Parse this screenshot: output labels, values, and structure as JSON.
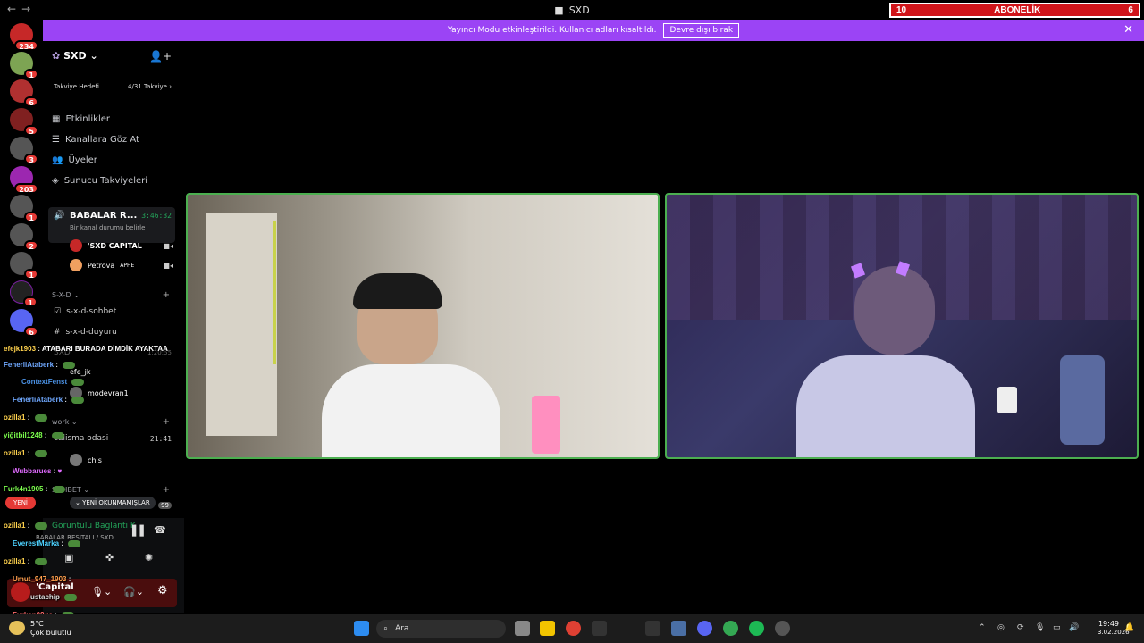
{
  "titlebar": {
    "title": "SXD",
    "nav_back": "←",
    "nav_fwd": "→"
  },
  "subscriber": {
    "left": "10",
    "label": "ABONELİK",
    "right": "6"
  },
  "banner": {
    "text": "Yayıncı Modu etkinleştirildi. Kullanıcı adları kısaltıldı.",
    "button": "Devre dışı bırak"
  },
  "guild_badges": [
    "234",
    "1",
    "6",
    "5",
    "3",
    "203",
    "1",
    "2",
    "1",
    "1",
    "6"
  ],
  "server": {
    "name": "SXD"
  },
  "boost": {
    "label": "Takviye Hedefi",
    "progress": "4/31 Takviye"
  },
  "menu": [
    "Etkinlikler",
    "Kanallara Göz At",
    "Üyeler",
    "Sunucu Takviyeleri"
  ],
  "voice": {
    "name": "BABALAR R...",
    "time": "3:46:32",
    "status": "Bir kanal durumu belirle"
  },
  "voice_users": [
    {
      "name": "'SXD CAPITAL"
    },
    {
      "name": "Petrova",
      "tag": "APHE"
    }
  ],
  "category1": "S-X-D",
  "channels1": [
    "s-x-d-sohbet",
    "s-x-d-duyuru"
  ],
  "hidden_voice": {
    "name": "SXD",
    "time": "1:20:55"
  },
  "hidden_users": [
    "efe_jk",
    "modevran1"
  ],
  "category2": "work",
  "work_channel": {
    "name": "calisma odasi",
    "time": "21:41"
  },
  "work_user": "chis",
  "category3": "SOHBET",
  "unread_badge": "99",
  "chat": [
    {
      "user": "efejk1903",
      "text": "ATABARI BURADA DİMDİK AYAKTAA",
      "color": "#ffd24d"
    },
    {
      "user": "FenerliAtaberk",
      "text": "",
      "color": "#6fa8ff"
    },
    {
      "user": "ContextFenst",
      "text": "",
      "color": "#4a90e2"
    },
    {
      "user": "FenerliAtaberk",
      "text": "",
      "color": "#6fa8ff"
    },
    {
      "user": "ozilla1",
      "text": "",
      "color": "#ffd24d"
    },
    {
      "user": "yiğitbil1248",
      "text": "",
      "color": "#7cff4d"
    },
    {
      "user": "ozilla1",
      "text": "",
      "color": "#ffd24d"
    },
    {
      "user": "Wubbarues",
      "text": "",
      "color": "#e06bff"
    },
    {
      "user": "Furk4n1905",
      "text": "",
      "color": "#7cff4d"
    },
    {
      "user": "ozilla1",
      "text": "",
      "color": "#ffd24d"
    },
    {
      "user": "EverestMarka",
      "text": "",
      "color": "#4dd2ff"
    },
    {
      "user": "ozilla1",
      "text": "",
      "color": "#ffd24d"
    },
    {
      "user": "Umut_947_1903",
      "text": "",
      "color": "#ff9f4d"
    },
    {
      "user": "ustachip",
      "text": "",
      "color": "#dddddd"
    },
    {
      "user": "Furkan09gs",
      "text": "",
      "color": "#ff6b6b"
    }
  ],
  "yeni": "YENİ",
  "unread_pill": "YENİ OKUNMAMIŞLAR",
  "connection": {
    "status": "Görüntülü Bağlantı K",
    "channel": "BABALAR RESITALI / SXD"
  },
  "user_panel": {
    "name": "'Capital"
  },
  "taskbar": {
    "search": "Ara",
    "weather_temp": "5°C",
    "weather_desc": "Çok bulutlu",
    "time": "19:49",
    "date": "3.02.2026"
  }
}
